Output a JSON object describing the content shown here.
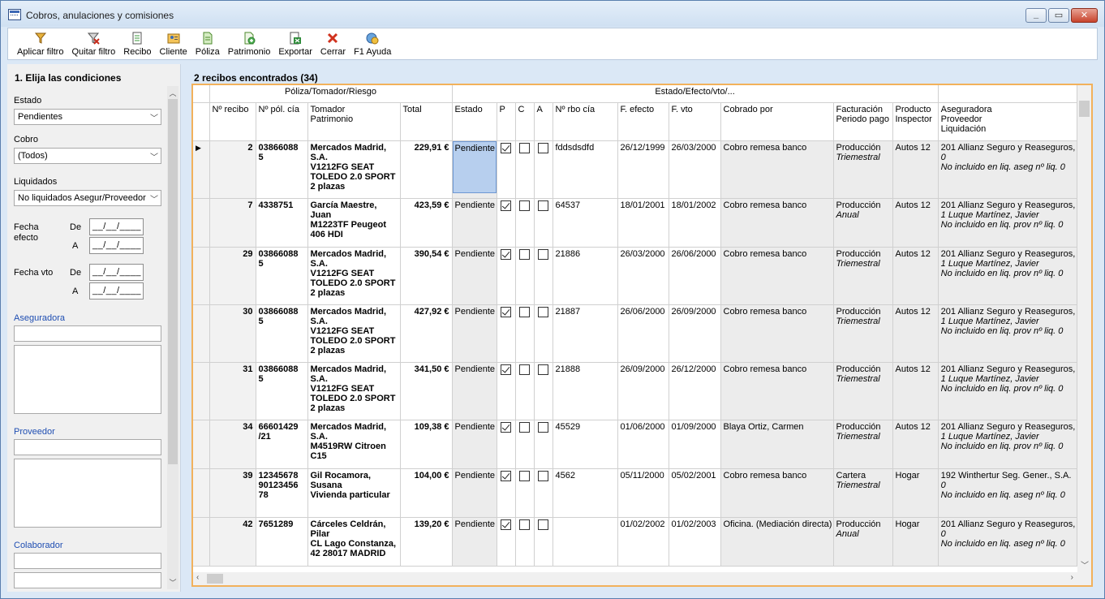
{
  "window": {
    "title": "Cobros, anulaciones y comisiones"
  },
  "toolbar": [
    {
      "label": "Aplicar filtro",
      "icon": "filter-apply-icon"
    },
    {
      "label": "Quitar filtro",
      "icon": "filter-remove-icon"
    },
    {
      "label": "Recibo",
      "icon": "receipt-icon"
    },
    {
      "label": "Cliente",
      "icon": "client-icon"
    },
    {
      "label": "Póliza",
      "icon": "policy-icon"
    },
    {
      "label": "Patrimonio",
      "icon": "asset-icon"
    },
    {
      "label": "Exportar",
      "icon": "export-icon"
    },
    {
      "label": "Cerrar",
      "icon": "close-icon"
    },
    {
      "label": "F1 Ayuda",
      "icon": "help-icon"
    }
  ],
  "filters": {
    "heading": "1. Elija las condiciones",
    "estado_label": "Estado",
    "estado_value": "Pendientes",
    "cobro_label": "Cobro",
    "cobro_value": "(Todos)",
    "liquidados_label": "Liquidados",
    "liquidados_value": "No liquidados Asegur/Proveedor",
    "fecha_efecto_label": "Fecha efecto",
    "fecha_vto_label": "Fecha vto",
    "de_label": "De",
    "a_label": "A",
    "date_placeholder": "__/__/____",
    "aseguradora_label": "Aseguradora",
    "proveedor_label": "Proveedor",
    "colaborador_label": "Colaborador"
  },
  "results": {
    "title": "2 recibos encontrados (34)",
    "group1": "Póliza/Tomador/Riesgo",
    "group2": "Estado/Efecto/vto/...",
    "columns": {
      "recibo": "Nº recibo",
      "pol": "Nº pól. cía",
      "tomador1": "Tomador",
      "tomador2": "Patrimonio",
      "total": "Total",
      "estado": "Estado",
      "p": "P",
      "c": "C",
      "a": "A",
      "rbo": "Nº rbo cía",
      "efecto": "F. efecto",
      "vto": "F. vto",
      "cobrado": "Cobrado por",
      "fact1": "Facturación",
      "fact2": "Periodo pago",
      "prod1": "Producto",
      "prod2": "Inspector",
      "aseg1": "Aseguradora",
      "aseg2": "Proveedor",
      "aseg3": "Liquidación"
    },
    "rows": [
      {
        "recibo": "2",
        "pol1": "03866088",
        "pol2": "5",
        "pol3": "",
        "tom1": "Mercados Madrid,",
        "tom2": "S.A.",
        "tom3": "V1212FG SEAT",
        "tom4": "TOLEDO 2.0 SPORT",
        "tom5": "2 plazas",
        "total": "229,91 €",
        "estado": "Pendiente",
        "p": true,
        "c": false,
        "a": false,
        "rbo": "fddsdsdfd",
        "efecto": "26/12/1999",
        "vto": "26/03/2000",
        "cobrado": "Cobro remesa banco",
        "fact1": "Producción",
        "fact2": "Triemestral",
        "prod": "Autos 12",
        "aseg1": "201 Allianz Seguro y Reaseguros,",
        "aseg2": "0",
        "aseg3": "No incluido en liq. aseg nº liq. 0"
      },
      {
        "recibo": "7",
        "pol1": "4338751",
        "pol2": "",
        "pol3": "",
        "tom1": "García Maestre,",
        "tom2": "Juan",
        "tom3": "M1223TF Peugeot",
        "tom4": "406 HDI",
        "tom5": "",
        "total": "423,59 €",
        "estado": "Pendiente",
        "p": true,
        "c": false,
        "a": false,
        "rbo": "64537",
        "efecto": "18/01/2001",
        "vto": "18/01/2002",
        "cobrado": "Cobro remesa banco",
        "fact1": "Producción",
        "fact2": "Anual",
        "prod": "Autos 12",
        "aseg1": "201 Allianz Seguro y Reaseguros,",
        "aseg2": "1 Luque Martínez, Javier",
        "aseg3": "No incluido en liq. prov nº liq. 0"
      },
      {
        "recibo": "29",
        "pol1": "03866088",
        "pol2": "5",
        "pol3": "",
        "tom1": "Mercados Madrid,",
        "tom2": "S.A.",
        "tom3": "V1212FG SEAT",
        "tom4": "TOLEDO 2.0 SPORT",
        "tom5": "2 plazas",
        "total": "390,54 €",
        "estado": "Pendiente",
        "p": true,
        "c": false,
        "a": false,
        "rbo": "21886",
        "efecto": "26/03/2000",
        "vto": "26/06/2000",
        "cobrado": "Cobro remesa banco",
        "fact1": "Producción",
        "fact2": "Triemestral",
        "prod": "Autos 12",
        "aseg1": "201 Allianz Seguro y Reaseguros,",
        "aseg2": "1 Luque Martínez, Javier",
        "aseg3": "No incluido en liq. prov nº liq. 0"
      },
      {
        "recibo": "30",
        "pol1": "03866088",
        "pol2": "5",
        "pol3": "",
        "tom1": "Mercados Madrid,",
        "tom2": "S.A.",
        "tom3": "V1212FG SEAT",
        "tom4": "TOLEDO 2.0 SPORT",
        "tom5": "2 plazas",
        "total": "427,92 €",
        "estado": "Pendiente",
        "p": true,
        "c": false,
        "a": false,
        "rbo": "21887",
        "efecto": "26/06/2000",
        "vto": "26/09/2000",
        "cobrado": "Cobro remesa banco",
        "fact1": "Producción",
        "fact2": "Triemestral",
        "prod": "Autos 12",
        "aseg1": "201 Allianz Seguro y Reaseguros,",
        "aseg2": "1 Luque Martínez, Javier",
        "aseg3": "No incluido en liq. prov nº liq. 0"
      },
      {
        "recibo": "31",
        "pol1": "03866088",
        "pol2": "5",
        "pol3": "",
        "tom1": "Mercados Madrid,",
        "tom2": "S.A.",
        "tom3": "V1212FG SEAT",
        "tom4": "TOLEDO 2.0 SPORT",
        "tom5": "2 plazas",
        "total": "341,50 €",
        "estado": "Pendiente",
        "p": true,
        "c": false,
        "a": false,
        "rbo": "21888",
        "efecto": "26/09/2000",
        "vto": "26/12/2000",
        "cobrado": "Cobro remesa banco",
        "fact1": "Producción",
        "fact2": "Triemestral",
        "prod": "Autos 12",
        "aseg1": "201 Allianz Seguro y Reaseguros,",
        "aseg2": "1 Luque Martínez, Javier",
        "aseg3": "No incluido en liq. prov nº liq. 0"
      },
      {
        "recibo": "34",
        "pol1": "66601429",
        "pol2": "/21",
        "pol3": "",
        "tom1": "Mercados Madrid,",
        "tom2": "S.A.",
        "tom3": "M4519RW Citroen",
        "tom4": "C15",
        "tom5": "",
        "total": "109,38 €",
        "estado": "Pendiente",
        "p": true,
        "c": false,
        "a": false,
        "rbo": "45529",
        "efecto": "01/06/2000",
        "vto": "01/09/2000",
        "cobrado": "Blaya Ortiz, Carmen",
        "fact1": "Producción",
        "fact2": "Triemestral",
        "prod": "Autos 12",
        "aseg1": "201 Allianz Seguro y Reaseguros,",
        "aseg2": "1 Luque Martínez, Javier",
        "aseg3": "No incluido en liq. prov nº liq. 0"
      },
      {
        "recibo": "39",
        "pol1": "12345678",
        "pol2": "90123456",
        "pol3": "78",
        "tom1": "Gil Rocamora,",
        "tom2": "Susana",
        "tom3": "Vivienda particular",
        "tom4": "",
        "tom5": "",
        "total": "104,00 €",
        "estado": "Pendiente",
        "p": true,
        "c": false,
        "a": false,
        "rbo": "4562",
        "efecto": "05/11/2000",
        "vto": "05/02/2001",
        "cobrado": "Cobro remesa banco",
        "fact1": "Cartera",
        "fact2": "Triemestral",
        "prod": "Hogar",
        "aseg1": "192 Winthertur Seg. Gener., S.A.",
        "aseg2": "0",
        "aseg3": "No incluido en liq. aseg nº liq. 0"
      },
      {
        "recibo": "42",
        "pol1": "7651289",
        "pol2": "",
        "pol3": "",
        "tom1": "Cárceles Celdrán,",
        "tom2": "Pilar",
        "tom3": "CL Lago Constanza,",
        "tom4": "42 28017 MADRID",
        "tom5": "",
        "total": "139,20 €",
        "estado": "Pendiente",
        "p": true,
        "c": false,
        "a": false,
        "rbo": "",
        "efecto": "01/02/2002",
        "vto": "01/02/2003",
        "cobrado": "Oficina. (Mediación directa)",
        "fact1": "Producción",
        "fact2": "Anual",
        "prod": "Hogar",
        "aseg1": "201 Allianz Seguro y Reaseguros,",
        "aseg2": "0",
        "aseg3": "No incluido en liq. aseg nº liq. 0"
      }
    ]
  }
}
